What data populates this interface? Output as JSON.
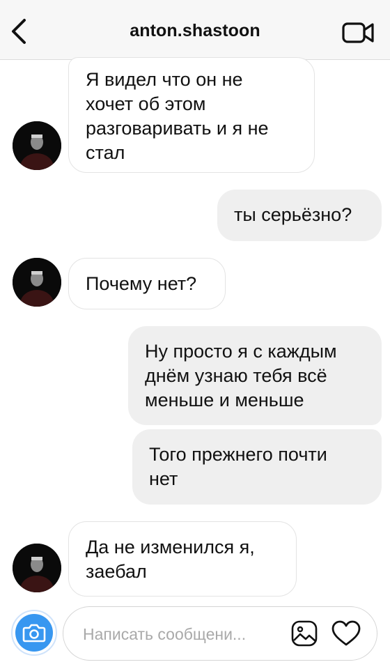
{
  "header": {
    "title": "anton.shastoon",
    "back_icon": "chevron-left-icon",
    "video_icon": "video-camera-icon"
  },
  "messages": [
    {
      "direction": "incoming",
      "text": "Я видел что он не\nхочет об этом\nразговаривать и я не\nстал"
    },
    {
      "direction": "outgoing",
      "text": "ты серьёзно?"
    },
    {
      "direction": "incoming",
      "text": "Почему нет?"
    },
    {
      "direction": "outgoing",
      "text": "Ну просто я с каждым\nднём узнаю тебя всё\nменьше и меньше"
    },
    {
      "direction": "outgoing",
      "text": "Того прежнего  почти\nнет"
    },
    {
      "direction": "incoming",
      "text": "Да не изменился я,\nзаебал"
    }
  ],
  "composer": {
    "placeholder": "Написать сообщени...",
    "value": "",
    "camera_icon": "camera-icon",
    "gallery_icon": "gallery-icon",
    "like_icon": "heart-icon"
  },
  "colors": {
    "header_bg": "#f7f7f7",
    "outgoing_bubble": "#efefef",
    "incoming_bubble": "#ffffff",
    "camera_button": "#3897f0"
  }
}
